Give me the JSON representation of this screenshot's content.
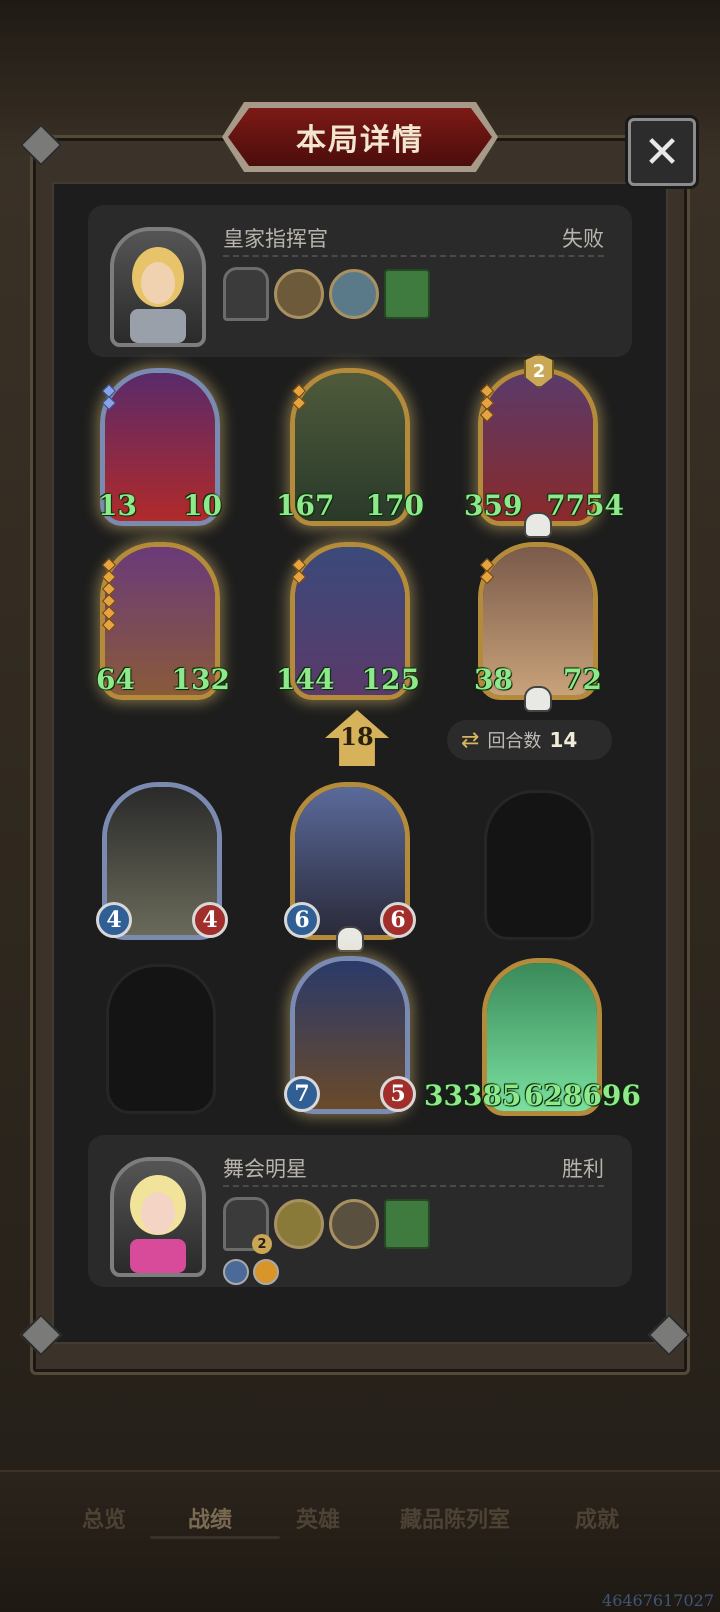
{
  "window": {
    "title": "本局详情",
    "close_icon": "✕"
  },
  "opponent": {
    "name": "皇家指挥官",
    "result": "失败",
    "portrait": "royal-commander-portrait",
    "items": [
      "banner-relic-item",
      "cuckoo-clock-item",
      "fish-bowl-item",
      "green-book-item"
    ]
  },
  "opponent_board": [
    {
      "name": "clown-card",
      "atk": "13",
      "hp": "10",
      "frame": "silver",
      "big": true,
      "colors": [
        "#5a2a6a",
        "#b02a2a"
      ]
    },
    {
      "name": "witch-card",
      "atk": "167",
      "hp": "170",
      "frame": "gold",
      "big": true,
      "colors": [
        "#4e5a3a",
        "#2a3a2a"
      ]
    },
    {
      "name": "viking-card",
      "atk": "359",
      "hp": "7754",
      "frame": "gold",
      "big": true,
      "badge": "2",
      "skull": true,
      "colors": [
        "#5a3a6a",
        "#8a2a2a"
      ]
    },
    {
      "name": "dwarf-card",
      "atk": "64",
      "hp": "132",
      "frame": "gold",
      "big": true,
      "colors": [
        "#6a3a7a",
        "#8a5a3a"
      ]
    },
    {
      "name": "elf-sorceress-card",
      "atk": "144",
      "hp": "125",
      "frame": "gold",
      "big": true,
      "colors": [
        "#3a4a7a",
        "#5a3a6a"
      ]
    },
    {
      "name": "toy-soldier-card",
      "atk": "38",
      "hp": "72",
      "frame": "gold",
      "big": true,
      "skull": true,
      "colors": [
        "#7a5a4a",
        "#c8a27a"
      ]
    }
  ],
  "turn": {
    "attack_value": "18",
    "rounds_label": "回合数",
    "rounds_value": "14"
  },
  "player_board": [
    {
      "name": "music-box-ballerina-card",
      "atk": "4",
      "hp": "4",
      "frame": "silver",
      "big": false,
      "colors": [
        "#2a2a2a",
        "#6a6a5a"
      ]
    },
    {
      "name": "hooded-cultist-card",
      "atk": "6",
      "hp": "6",
      "frame": "gold",
      "big": false,
      "skull": true,
      "colors": [
        "#5a6a9a",
        "#2a2a3a"
      ]
    },
    {
      "name": "pumpkin-knight-card",
      "atk": "7",
      "hp": "5",
      "frame": "silver",
      "big": false,
      "colors": [
        "#2a3a6a",
        "#6a4a2a"
      ]
    },
    {
      "name": "ghost-family-card",
      "atk": "33385",
      "hp": "628696",
      "frame": "gold",
      "big": true,
      "colors": [
        "#3a8a5a",
        "#7ae0a0"
      ]
    }
  ],
  "player": {
    "name": "舞会明星",
    "result": "胜利",
    "portrait": "ball-star-portrait",
    "items": [
      "shadow-dancer-item",
      "duck-item",
      "stew-pot-item",
      "green-book-item"
    ],
    "item_badge": "2",
    "mini_items": [
      "crossed-swords-icon",
      "gold-swirl-icon"
    ]
  },
  "nav": {
    "items": [
      "总览",
      "战绩",
      "英雄",
      "藏品陈列室",
      "成就"
    ],
    "active_index": 1
  },
  "watermark": "46467617027"
}
